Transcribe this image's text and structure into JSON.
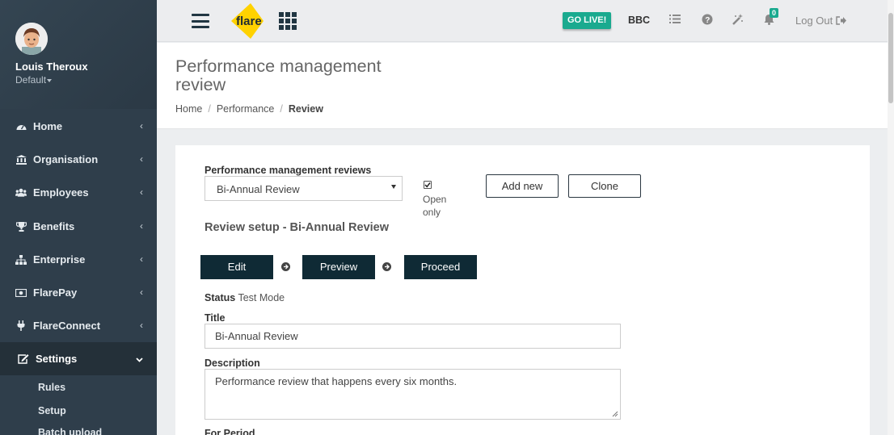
{
  "user": {
    "name": "Louis Theroux",
    "role": "Default"
  },
  "sidebar": {
    "items": [
      {
        "label": "Home",
        "icon": "dashboard-icon"
      },
      {
        "label": "Organisation",
        "icon": "bank-icon"
      },
      {
        "label": "Employees",
        "icon": "users-icon"
      },
      {
        "label": "Benefits",
        "icon": "trophy-icon"
      },
      {
        "label": "Enterprise",
        "icon": "sitemap-icon"
      },
      {
        "label": "FlarePay",
        "icon": "money-icon"
      },
      {
        "label": "FlareConnect",
        "icon": "plug-icon"
      },
      {
        "label": "Settings",
        "icon": "edit-icon"
      }
    ],
    "subitems": [
      "Rules",
      "Setup",
      "Batch upload"
    ]
  },
  "topbar": {
    "logo_text": "flare",
    "go_live": "GO LIVE!",
    "company": "BBC",
    "notification_count": "0",
    "logout": "Log Out"
  },
  "page": {
    "title": "Performance management review",
    "breadcrumb": [
      "Home",
      "Performance",
      "Review"
    ]
  },
  "form": {
    "reviews_label": "Performance management reviews",
    "selected_review": "Bi-Annual Review",
    "open_only_checked": true,
    "open_only_label": "Open only",
    "add_new": "Add new",
    "clone": "Clone",
    "setup_title": "Review setup - Bi-Annual Review",
    "steps": [
      "Edit",
      "Preview",
      "Proceed"
    ],
    "status_label": "Status",
    "status_value": "Test Mode",
    "title_label": "Title",
    "title_value": "Bi-Annual Review",
    "description_label": "Description",
    "description_value": "Performance review that happens every six months.",
    "period_label": "For Period"
  },
  "colors": {
    "sidebar": "#2f3e4b",
    "accent": "#1aaa8f",
    "dark_button": "#0f2a35",
    "logo": "#ffd200"
  }
}
